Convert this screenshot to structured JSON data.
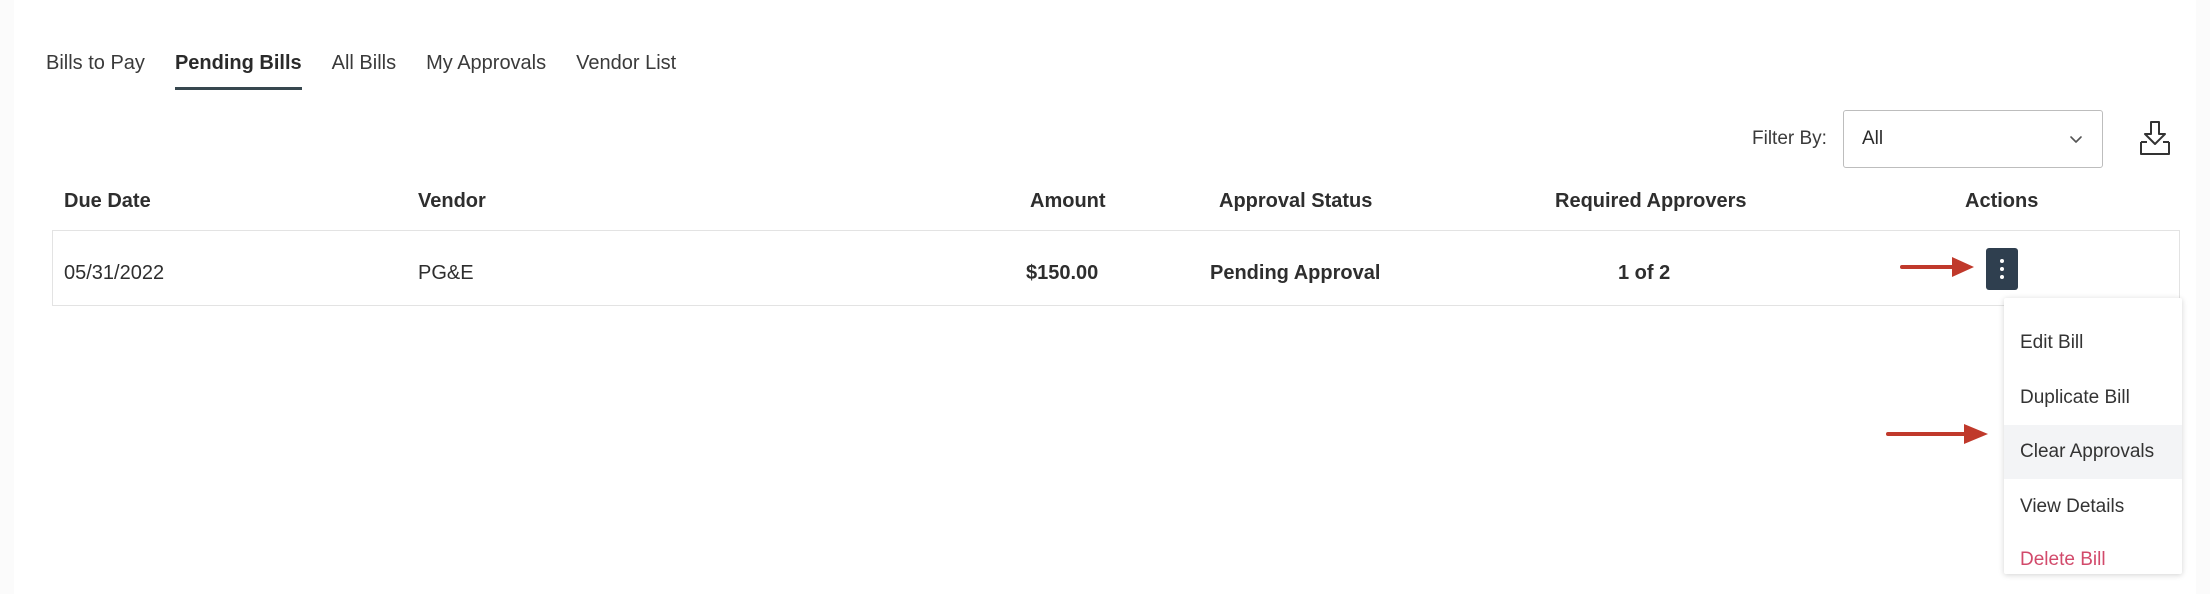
{
  "tabs": [
    {
      "label": "Bills to Pay",
      "active": false
    },
    {
      "label": "Pending Bills",
      "active": true
    },
    {
      "label": "All Bills",
      "active": false
    },
    {
      "label": "My Approvals",
      "active": false
    },
    {
      "label": "Vendor List",
      "active": false
    }
  ],
  "filter": {
    "label": "Filter By:",
    "selected": "All"
  },
  "icons": {
    "download": "download-icon",
    "chevron": "chevron-down-icon",
    "kebab": "more-vertical-icon"
  },
  "table": {
    "headers": {
      "due_date": "Due Date",
      "vendor": "Vendor",
      "amount": "Amount",
      "approval_status": "Approval Status",
      "required_approvers": "Required Approvers",
      "actions": "Actions"
    },
    "rows": [
      {
        "due_date": "05/31/2022",
        "vendor": "PG&E",
        "amount": "$150.00",
        "approval_status": "Pending Approval",
        "required_approvers": "1 of 2"
      }
    ]
  },
  "menu": {
    "items": [
      {
        "label": "Edit Bill"
      },
      {
        "label": "Duplicate Bill"
      },
      {
        "label": "Clear Approvals",
        "highlighted": true
      },
      {
        "label": "View Details"
      },
      {
        "label": "Delete Bill",
        "danger": true
      }
    ]
  },
  "colors": {
    "active_tab_underline": "#37474f",
    "kebab_button": "#2f3f4f",
    "danger_text": "#d24a6b",
    "annotation_arrow": "#c0392b"
  }
}
